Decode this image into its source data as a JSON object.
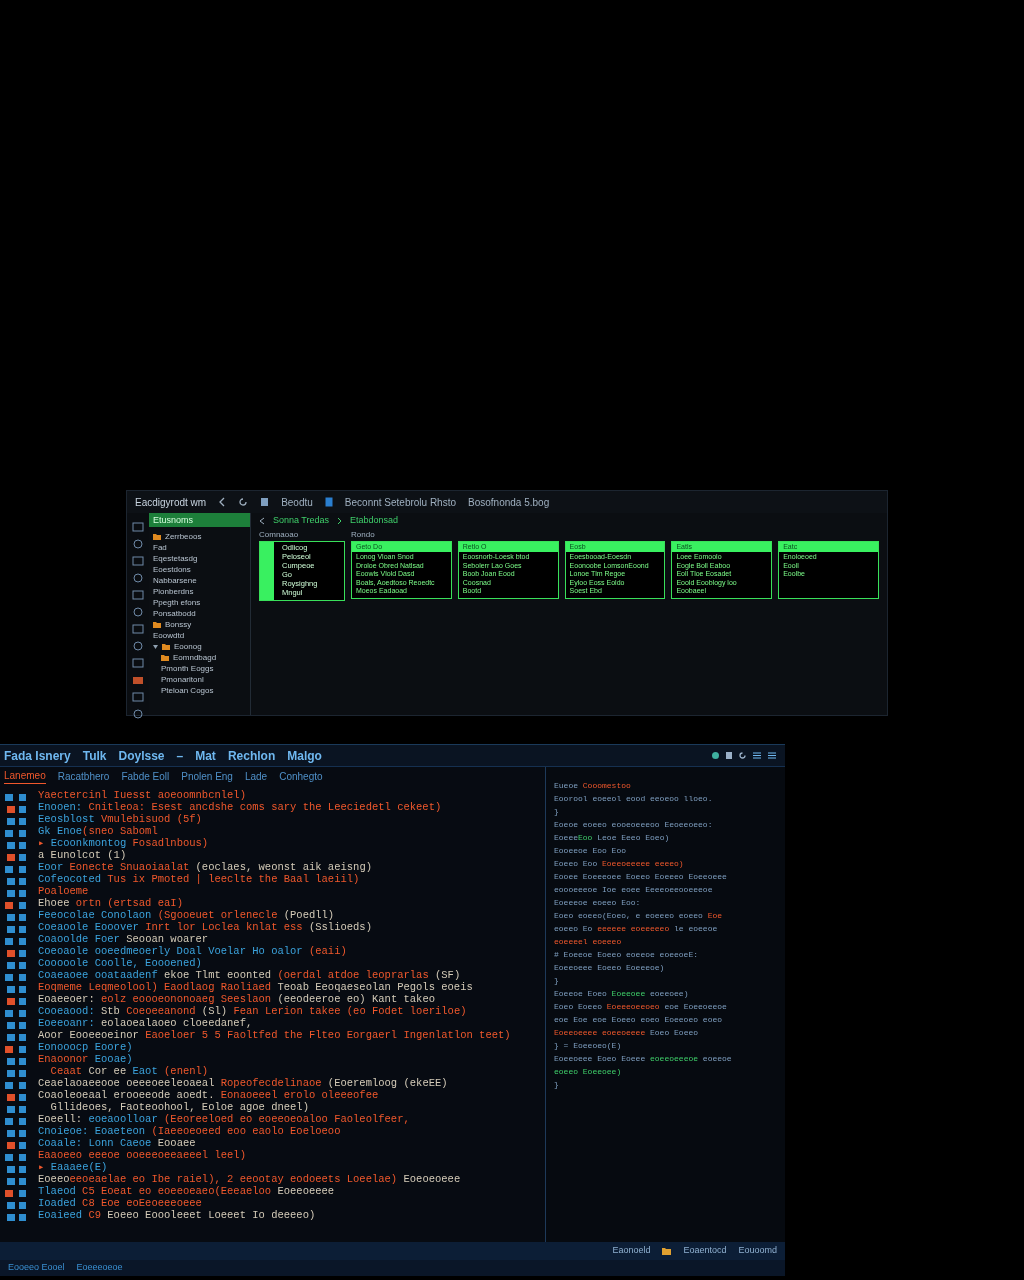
{
  "top_window": {
    "toolbar": {
      "title": "Eacdigyrodt wm",
      "items": [
        "Beodtu",
        "Beconnt Setebrolu Rhsto",
        "Bosofnonda 5.bog"
      ]
    },
    "sidebar": {
      "header": "Etusnoms",
      "items": [
        {
          "label": "Zerrbeoos",
          "kind": "folder"
        },
        {
          "label": "Fad",
          "kind": "file"
        },
        {
          "label": "Eqestetasdg",
          "kind": "file"
        },
        {
          "label": "Eoestdons",
          "kind": "file"
        },
        {
          "label": "Nabbarsene",
          "kind": "file"
        },
        {
          "label": "Pionberdns",
          "kind": "file"
        },
        {
          "label": "Ppegth efons",
          "kind": "file"
        },
        {
          "label": "Ponsatbodd",
          "kind": "file"
        },
        {
          "label": "Bonssy",
          "kind": "folder"
        },
        {
          "label": "Eoowdtd",
          "kind": "file"
        },
        {
          "label": "Eoonog",
          "kind": "folder",
          "expanded": true,
          "children": [
            {
              "label": "Eomndbagd",
              "kind": "folder"
            },
            {
              "label": "Pmonth Eoggs",
              "kind": "file"
            },
            {
              "label": "Pmonaritonl",
              "kind": "file"
            },
            {
              "label": "Pteloan Cogos",
              "kind": "file"
            }
          ]
        }
      ]
    },
    "breadcrumb": [
      "Sonna Tredas",
      "Etabdonsad"
    ],
    "board": {
      "labels": [
        "Comnaoao",
        "Rondo"
      ],
      "cards": [
        {
          "kind": "strip",
          "lines": [
            "Odlicog",
            "Peloseol",
            "Cumpeoe",
            "Go",
            "Roysighng",
            "Mngul"
          ]
        },
        {
          "kind": "headed",
          "header": "Geto Do",
          "lines": [
            "Lonog Vloan Snod",
            "Droloe Obred Natlsad",
            "Eoowls Vlold Dasd",
            "Boals, Aoedtoso Reoedtc",
            "Moeos Eadaoad"
          ]
        },
        {
          "kind": "headed",
          "header": "Retlo O",
          "lines": [
            "Eoosnorb-Loesk btod",
            "Sebolerr Lao Goes",
            "Boob Joan Eood",
            "Coosnad",
            "Bootd"
          ]
        },
        {
          "kind": "headed",
          "header": "Eosb",
          "lines": [
            "Eoesbooad-Eoesdn",
            "Eoonoobe LomsonEoond",
            "Lonoe Tlm Regoe",
            "Eyloo Eoss Eoldo",
            "Soest Ebd"
          ]
        },
        {
          "kind": "headed",
          "header": "Eatls",
          "lines": [
            "Loee Eomoolo",
            "Eogle Boll Eaboo",
            "Eoll Tloe Eosadet",
            "Eoold Eooblogy loo",
            "Eoobaeel"
          ]
        },
        {
          "kind": "headed",
          "header": "Eatc",
          "lines": [
            "Enoloeoed",
            "Eooll",
            "Eoolbe"
          ]
        }
      ]
    }
  },
  "code_window": {
    "menu": [
      "Fada Isnery",
      "Tulk",
      "Doylsse",
      "–",
      "Mat",
      "Rechlon",
      "Malgo"
    ],
    "tabs": [
      {
        "label": "Lanemeo",
        "selected": true
      },
      {
        "label": "Racatbhero",
        "selected": false
      },
      {
        "label": "Fabde Eoll",
        "selected": false
      },
      {
        "label": "Pnolen Eng",
        "selected": false
      },
      {
        "label": "Lade",
        "selected": false
      },
      {
        "label": "Conhegto",
        "selected": false
      }
    ],
    "code_lines": [
      [
        {
          "kind": "string",
          "text": "Yaectercinl Iuesst aoeoomnbcnlel)"
        }
      ],
      [
        {
          "kind": "keyword",
          "text": "Enooen:"
        },
        {
          "kind": "string",
          "text": " Cnitleoa: Esest ancdshe coms sary the Leeciedetl cekeet)"
        }
      ],
      [
        {
          "kind": "keyword",
          "text": "Eeosblost"
        },
        {
          "kind": "string",
          "text": " Vmulebisuod (5f)"
        }
      ],
      [
        {
          "kind": "keyword",
          "text": "Gk Enoe"
        },
        {
          "kind": "string",
          "text": "(sneo Saboml"
        }
      ],
      [
        {
          "kind": "string",
          "text": "▸ "
        },
        {
          "kind": "keyword",
          "text": "Ecoonkmontog"
        },
        {
          "kind": "string",
          "text": " Fosadlnbous)"
        }
      ],
      [
        {
          "kind": "plain",
          "text": "a Eunolcot (1)"
        }
      ],
      [
        {
          "kind": "keyword",
          "text": "Eoor"
        },
        {
          "kind": "string",
          "text": " Eonecte Snuaoiaalat"
        },
        {
          "kind": "plain",
          "text": " (eoclaes, weonst aik aeisng)"
        }
      ],
      [
        {
          "kind": "keyword",
          "text": "Cofeocoted"
        },
        {
          "kind": "string",
          "text": " Tus ix Pmoted | leeclte the Baal laeiil)"
        }
      ],
      [
        {
          "kind": "string",
          "text": "Poaloeme"
        }
      ],
      [
        {
          "kind": "plain",
          "text": "Ehoee "
        },
        {
          "kind": "string",
          "text": "ortn (ertsad eaI)"
        }
      ],
      [
        {
          "kind": "keyword",
          "text": "Feeocolae Conolaon"
        },
        {
          "kind": "string",
          "text": " (Sgooeuet orlenecle"
        },
        {
          "kind": "plain",
          "text": " (Poedll)"
        }
      ],
      [
        {
          "kind": "keyword",
          "text": "Coeaoole Eooover"
        },
        {
          "kind": "string",
          "text": " Inrt lor Loclea knlat ess"
        },
        {
          "kind": "plain",
          "text": " (Sslioeds)"
        }
      ],
      [
        {
          "kind": "keyword",
          "text": "Coaoolde Foer"
        },
        {
          "kind": "plain",
          "text": " Seooan woarer"
        }
      ],
      [
        {
          "kind": "keyword",
          "text": "Coeoaole ooeedmeoerly Doal Voelar Ho oalor"
        },
        {
          "kind": "string",
          "text": " (eaii)"
        }
      ],
      [
        {
          "kind": "keyword",
          "text": "Cooooole Coolle, Eoooened)"
        }
      ],
      [
        {
          "kind": "keyword",
          "text": "Coaeaoee ooataadenf"
        },
        {
          "kind": "plain",
          "text": " ekoe Tlmt eoonted"
        },
        {
          "kind": "string",
          "text": " (oerdal atdoe leoprarlas"
        },
        {
          "kind": "plain",
          "text": " (SF)"
        }
      ],
      [
        {
          "kind": "string",
          "text": "Eoqmeme Leqmeolool) Eaodlaog Raoliaed"
        },
        {
          "kind": "plain",
          "text": " Teoab Eeoqaeseolan Pegols eoeis"
        }
      ],
      [
        {
          "kind": "plain",
          "text": "Eoaeeoer:"
        },
        {
          "kind": "string",
          "text": " eolz eoooeononoaeg Seeslaon"
        },
        {
          "kind": "plain",
          "text": " (eeodeeroe eo) Kant takeo"
        }
      ],
      [
        {
          "kind": "keyword",
          "text": "Cooeaood:"
        },
        {
          "kind": "plain",
          "text": " Stb"
        },
        {
          "kind": "string",
          "text": " Coeoeeanond"
        },
        {
          "kind": "plain",
          "text": " (Sl)"
        },
        {
          "kind": "string",
          "text": " Fean Lerion takee (eo Fodet loeriloe)"
        }
      ],
      [
        {
          "kind": "keyword",
          "text": "Eoeeoanr:"
        },
        {
          "kind": "plain",
          "text": " eolaoealaoeo cloeedanef,"
        }
      ],
      [
        {
          "kind": "plain",
          "text": "Aoor Eooeeoeinor"
        },
        {
          "kind": "string",
          "text": " Eaoeloer 5 5 Faoltfed the Flteo Eorgaerl Ingenlatlon teet)"
        }
      ],
      [
        {
          "kind": "keyword",
          "text": "Eonooocp Eoore)"
        }
      ],
      [
        {
          "kind": "string",
          "text": "Enaoonor"
        },
        {
          "kind": "keyword",
          "text": " Eooae)"
        }
      ],
      [
        {
          "kind": "string",
          "text": "  Ceaat"
        },
        {
          "kind": "plain",
          "text": " Cor ee"
        },
        {
          "kind": "keyword",
          "text": " Eaot"
        },
        {
          "kind": "string",
          "text": " (enenl)"
        }
      ],
      [
        {
          "kind": "plain",
          "text": "Ceaelaoaeeooe oeeeoeeleoaeal"
        },
        {
          "kind": "string",
          "text": " Ropeofecdelinaoe"
        },
        {
          "kind": "plain",
          "text": " (Eoeremloog (ekeEE)"
        }
      ],
      [
        {
          "kind": "plain",
          "text": "Coaoleoeaal erooeeode aoedt."
        },
        {
          "kind": "string",
          "text": " Eonaoeeel erolo oleeeofee"
        }
      ],
      [
        {
          "kind": "plain",
          "text": "  Gllideoes, Faoteoohool, Eoloe agoe dneel)"
        }
      ],
      [
        {
          "kind": "plain",
          "text": "Eoeell:"
        },
        {
          "kind": "keyword",
          "text": " eoeaoolloar"
        },
        {
          "kind": "string",
          "text": " (Eeoreeloed eo eoeeoeoaloo Faoleolfeer,"
        }
      ],
      [
        {
          "kind": "keyword",
          "text": "Cnoieoe: Eoaeteon"
        },
        {
          "kind": "string",
          "text": " (Iaeeoeoeed eoo eaolo Eoeloeoo"
        }
      ],
      [
        {
          "kind": "keyword",
          "text": "Coaale: Lonn Caeoe"
        },
        {
          "kind": "plain",
          "text": " Eooaee"
        }
      ],
      [
        {
          "kind": "string",
          "text": "Eaaoeeo eeeoe ooeeeoeeaeeel leel)"
        }
      ],
      [
        {
          "kind": "string",
          "text": "▸ "
        },
        {
          "kind": "keyword",
          "text": "Eaaaee(E)"
        }
      ],
      [
        {
          "kind": "plain",
          "text": "Eoeeo"
        },
        {
          "kind": "string",
          "text": "eeoeaelae eo Ibe raiel), 2 eeootay eodoeets Loeelae)"
        },
        {
          "kind": "plain",
          "text": " Eoeoeoeee"
        }
      ],
      [
        {
          "kind": "keyword",
          "text": "Tlaeod"
        },
        {
          "kind": "string",
          "text": " C5 Eoeat eo eoeeoeaeo(Eeeaeloo"
        },
        {
          "kind": "plain",
          "text": " Eoeeoeeee"
        }
      ],
      [
        {
          "kind": "keyword",
          "text": "Ioaded"
        },
        {
          "kind": "string",
          "text": " C8 Eoe eoEeoeeeoeee"
        }
      ],
      [
        {
          "kind": "keyword",
          "text": "Eoaieed"
        },
        {
          "kind": "string",
          "text": " C9"
        },
        {
          "kind": "plain",
          "text": " Eoeeo Eoooleeet Loeeet Io deeeeo)"
        }
      ]
    ],
    "side_lines": [
      [
        {
          "kind": "plain",
          "text": "Eueoe"
        },
        {
          "kind": "string",
          "text": " Cooomestoo"
        }
      ],
      [
        {
          "kind": "plain",
          "text": "Eoorool eoeeol eood eeoeoo lloeo."
        }
      ],
      [
        {
          "kind": "plain",
          "text": "}"
        }
      ],
      [
        {
          "kind": "plain",
          "text": "Eoeoe eoeeo eooeoeeeoo Eeoeeoeeo:"
        }
      ],
      [
        {
          "kind": "plain",
          "text": "Eoeee"
        },
        {
          "kind": "green",
          "text": "Eoo"
        },
        {
          "kind": "plain",
          "text": " Leoe Eeeo Eoeo)"
        }
      ],
      [
        {
          "kind": "plain",
          "text": "Eooeeoe Eoo Eoo"
        }
      ],
      [
        {
          "kind": "plain",
          "text": "Eoeeo Eoo"
        },
        {
          "kind": "string",
          "text": " Eoeeoeeeee eeeeo)"
        }
      ],
      [
        {
          "kind": "plain",
          "text": "Eooee Eoeeeoee Eoeeo Eoeeeo Eoeeoeee"
        }
      ],
      [
        {
          "kind": "plain",
          "text": "eoooeeeoe Ioe eoee Eeeeoeeooeeeoe"
        }
      ],
      [
        {
          "kind": "plain",
          "text": "Eoeeeoe eoeeo Eoo:"
        }
      ],
      [
        {
          "kind": "plain",
          "text": "Eoeo eoeeo(Eoeo, e eoeeeo eoeeo"
        },
        {
          "kind": "string",
          "text": " Eoe"
        }
      ],
      [
        {
          "kind": "plain",
          "text": "eoeeo Eo"
        },
        {
          "kind": "string",
          "text": " eeeeee eoeeeeeo"
        },
        {
          "kind": "plain",
          "text": " le eoeeoe"
        }
      ],
      [
        {
          "kind": "string",
          "text": "eoeeeel eoeeeo"
        }
      ],
      [
        {
          "kind": "plain",
          "text": "# Eoeeoe Eoeeo eoeeoe eoeeoeE:"
        }
      ],
      [
        {
          "kind": "plain",
          "text": "Eoeeoeee Eoeeo Eoeeeoe)"
        }
      ],
      [
        {
          "kind": "plain",
          "text": "}"
        }
      ],
      [
        {
          "kind": "plain",
          "text": "Eoeeoe Eoeo"
        },
        {
          "kind": "green",
          "text": " Eoeeoee"
        },
        {
          "kind": "plain",
          "text": " eoeeoee)"
        }
      ],
      [
        {
          "kind": "plain",
          "text": "Eoeo Eoeeo"
        },
        {
          "kind": "string",
          "text": " Eoeeeoeeoeo"
        },
        {
          "kind": "plain",
          "text": " eoe Eoeeoeeoe"
        }
      ],
      [
        {
          "kind": "plain",
          "text": "eoe Eoe eoe Eoeeo eoeo Eoeeoeo eoeo"
        }
      ],
      [
        {
          "kind": "string",
          "text": "Eoeeoeeee eoeeoeeee"
        },
        {
          "kind": "plain",
          "text": " Eoeo Eoeeo"
        }
      ],
      [
        {
          "kind": "plain",
          "text": "} = Eoeeoeo(E)"
        }
      ],
      [
        {
          "kind": "plain",
          "text": "Eoeeoeee Eoeo Eoeee"
        },
        {
          "kind": "green",
          "text": " eoeeoeeeoe"
        },
        {
          "kind": "plain",
          "text": " eoeeoe"
        }
      ],
      [
        {
          "kind": "green",
          "text": "eoeeo Eoeeoee)"
        }
      ],
      [
        {
          "kind": "plain",
          "text": "}"
        }
      ]
    ],
    "status_items": [
      "Eaonoeld",
      "Eoaentocd",
      "Eouoomd"
    ],
    "footer": [
      "Eooeeo Eooel",
      "Eoeeeoeoe"
    ]
  }
}
